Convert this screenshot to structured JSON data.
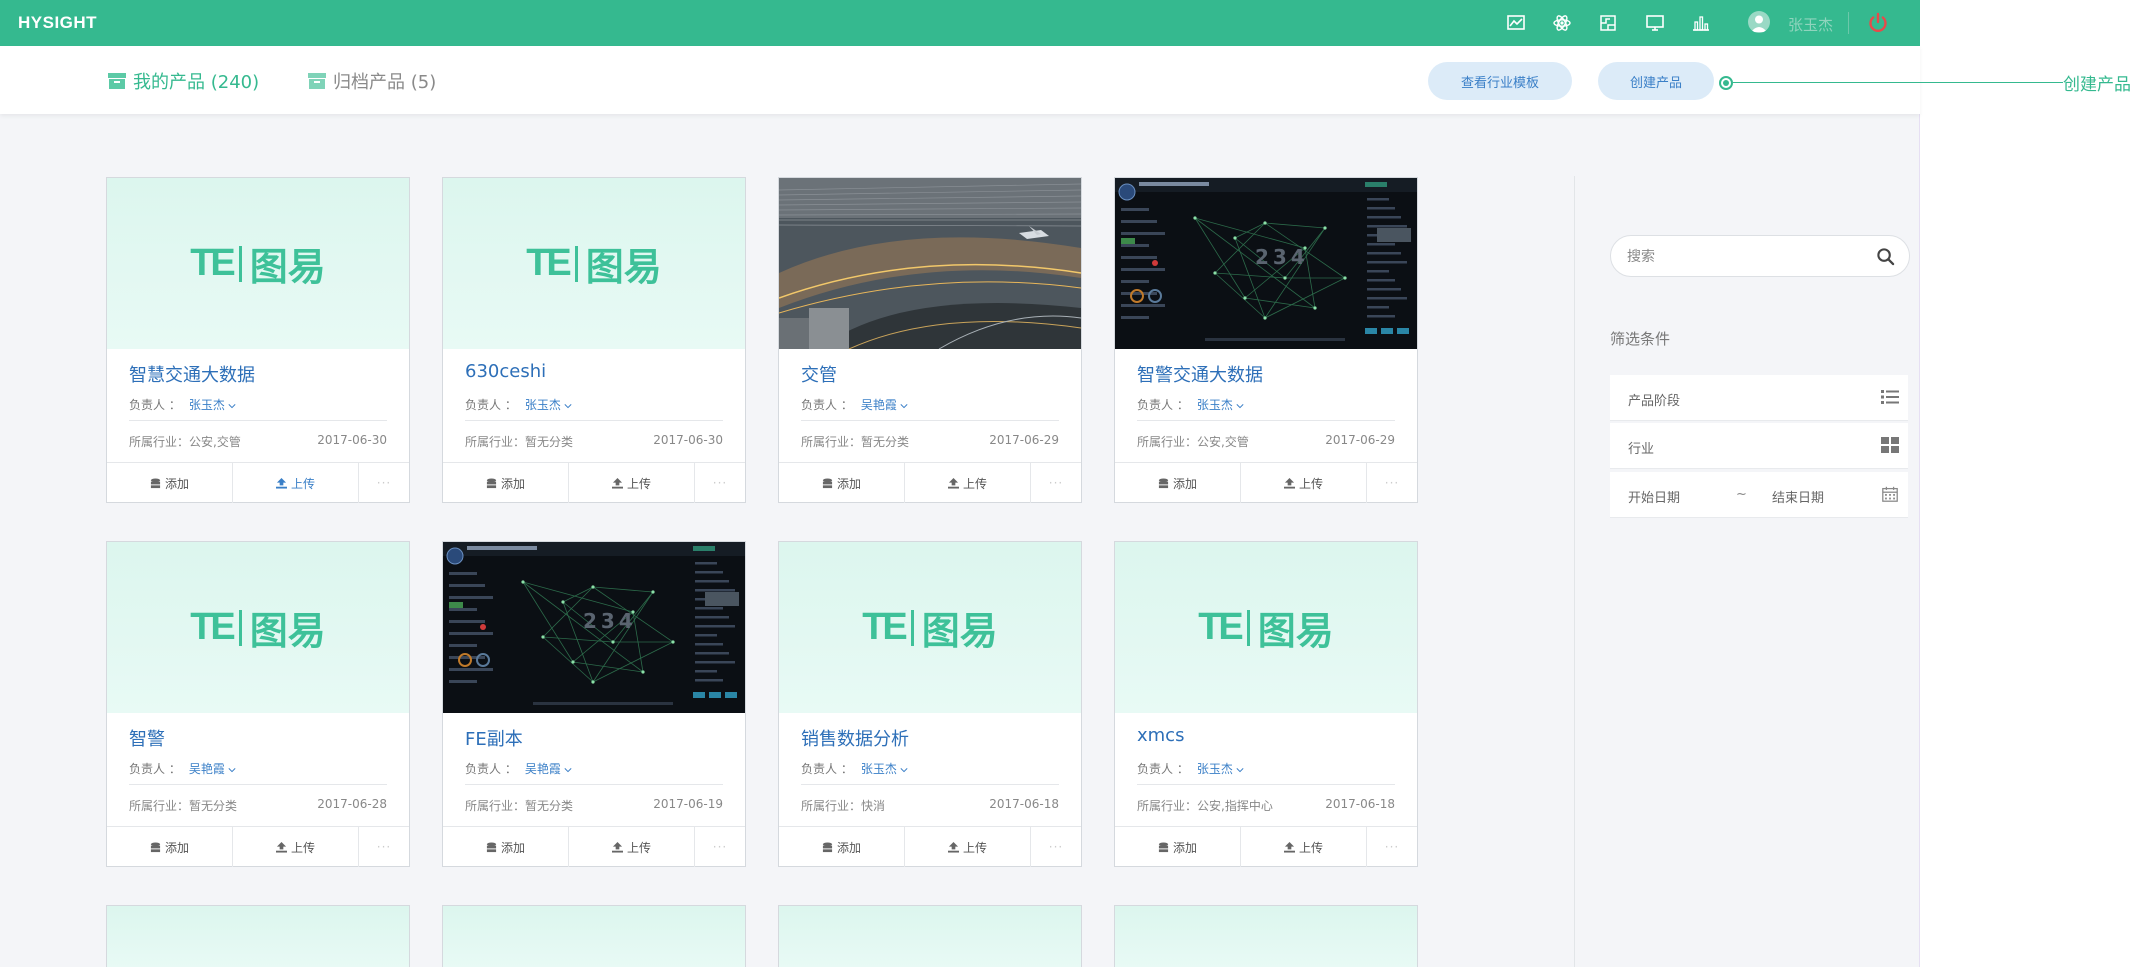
{
  "header": {
    "brand": "HYSIGHT",
    "user_name": "张玉杰",
    "icons": [
      "monitor-chart-icon",
      "atom-icon",
      "puzzle-icon",
      "display-icon",
      "bar-chart-icon"
    ],
    "accent_color": "#35b98f"
  },
  "tabs": {
    "mine": "我的产品 (240)",
    "archived": "归档产品 (5)"
  },
  "toolbar": {
    "templates_label": "查看行业模板",
    "create_label": "创建产品"
  },
  "annotation": {
    "label": "创建产品"
  },
  "card_labels": {
    "owner_prefix": "负责人 ：",
    "add": "添加",
    "upload": "上传",
    "more": "···"
  },
  "logo": {
    "mark": "TE",
    "text": "图易"
  },
  "cards": [
    {
      "title": "智慧交通大数据",
      "owner": "张玉杰",
      "industry": "所属行业：公安,交管",
      "date": "2017-06-30",
      "thumb": "logo"
    },
    {
      "title": "630ceshi",
      "owner": "张玉杰",
      "industry": "所属行业：暂无分类",
      "date": "2017-06-30",
      "thumb": "logo"
    },
    {
      "title": "交管",
      "owner": "吴艳霞",
      "industry": "所属行业：暂无分类",
      "date": "2017-06-29",
      "thumb": "airport"
    },
    {
      "title": "智警交通大数据",
      "owner": "张玉杰",
      "industry": "所属行业：公安,交管",
      "date": "2017-06-29",
      "thumb": "dashboard"
    },
    {
      "title": "智警",
      "owner": "吴艳霞",
      "industry": "所属行业：暂无分类",
      "date": "2017-06-28",
      "thumb": "logo"
    },
    {
      "title": "FE副本",
      "owner": "吴艳霞",
      "industry": "所属行业：暂无分类",
      "date": "2017-06-19",
      "thumb": "dashboard"
    },
    {
      "title": "销售数据分析",
      "owner": "张玉杰",
      "industry": "所属行业：快消",
      "date": "2017-06-18",
      "thumb": "logo"
    },
    {
      "title": "xmcs",
      "owner": "张玉杰",
      "industry": "所属行业：公安,指挥中心",
      "date": "2017-06-18",
      "thumb": "logo"
    }
  ],
  "filters": {
    "search_placeholder": "搜索",
    "title": "筛选条件",
    "stage": "产品阶段",
    "industry": "行业",
    "start_date": "开始日期",
    "date_separator": "~",
    "end_date": "结束日期"
  },
  "dashboard_number": "234"
}
